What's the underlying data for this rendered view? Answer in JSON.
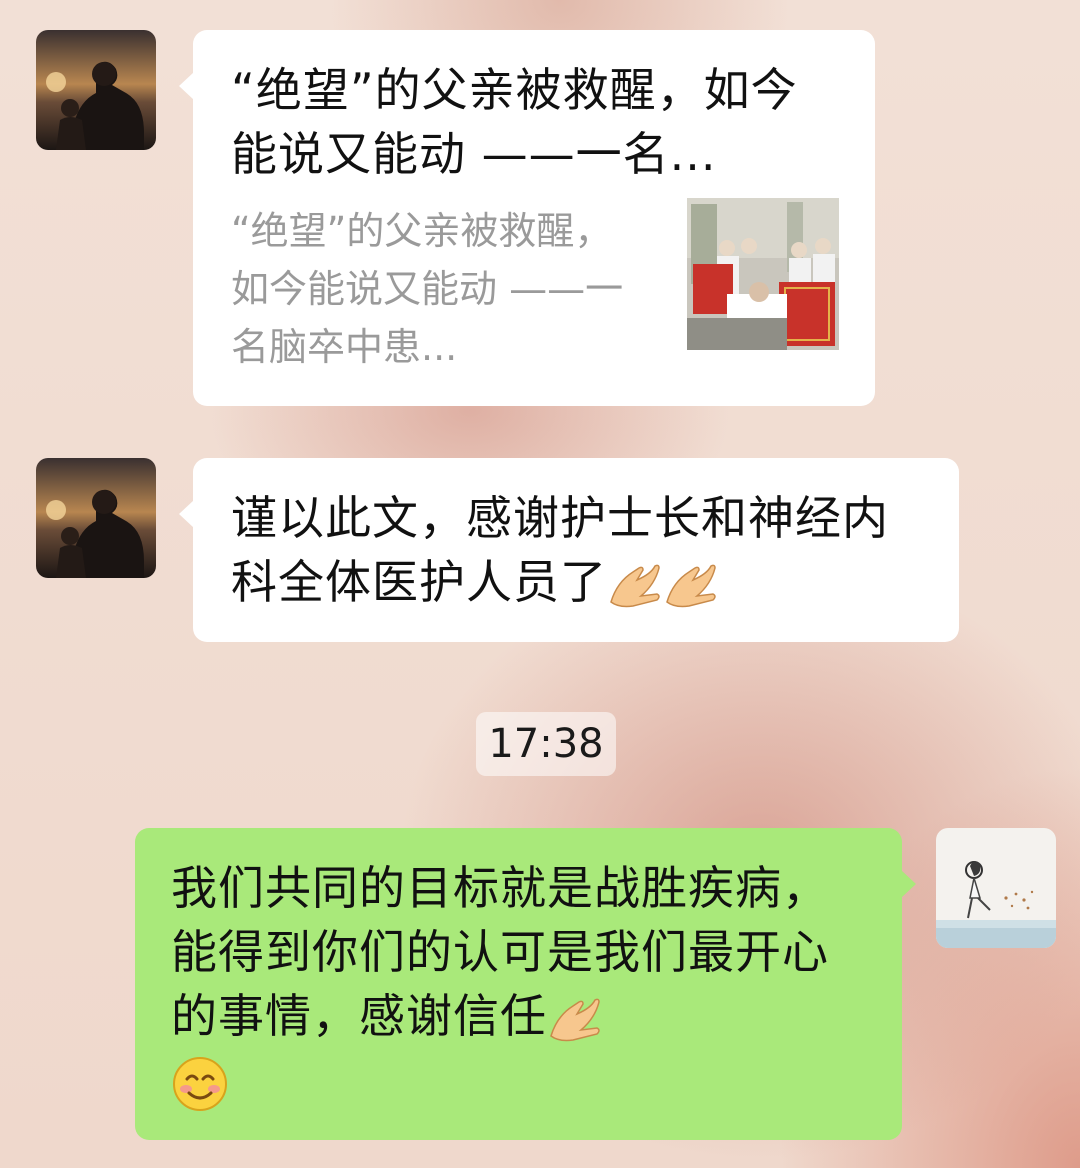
{
  "messages": [
    {
      "type": "link_card",
      "sender": "contact",
      "title": "“绝望”的父亲被救醒，如今能说又能动 ——一名...",
      "description": "“绝望”的父亲被救醒，如今能说又能动 ——一名脑卒中患..."
    },
    {
      "type": "text",
      "sender": "contact",
      "text": "谨以此文，感谢护士长和神经内科全体医护人员了"
    },
    {
      "type": "timestamp",
      "text": "17:38"
    },
    {
      "type": "text",
      "sender": "me",
      "text": "我们共同的目标就是战胜疾病，能得到你们的认可是我们最开心的事情，感谢信任"
    }
  ],
  "icons": {
    "contact_avatar": "father-child-sunset-avatar",
    "my_avatar": "sketch-girl-avatar",
    "card_thumbnail": "hospital-group-photo",
    "emoji_hand": "clasped-hands-emoji",
    "emoji_smile": "blushing-smile-emoji"
  },
  "colors": {
    "incoming_bubble": "#ffffff",
    "outgoing_bubble": "#a9e97a",
    "description_text": "#9a9a9a"
  }
}
